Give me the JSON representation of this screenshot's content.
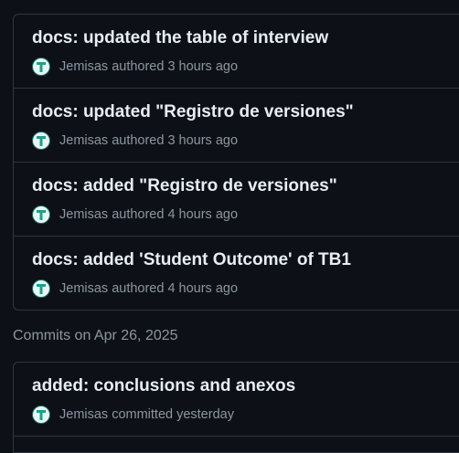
{
  "group_1": {
    "commits": [
      {
        "title": "docs: updated the table of interview",
        "author": "Jemisas",
        "verb": "authored",
        "time": "3 hours ago"
      },
      {
        "title": "docs: updated \"Registro de versiones\"",
        "author": "Jemisas",
        "verb": "authored",
        "time": "3 hours ago"
      },
      {
        "title": "docs: added \"Registro de versiones\"",
        "author": "Jemisas",
        "verb": "authored",
        "time": "4 hours ago"
      },
      {
        "title": "docs: added 'Student Outcome' of TB1",
        "author": "Jemisas",
        "verb": "authored",
        "time": "4 hours ago"
      }
    ]
  },
  "group_2": {
    "header": "Commits on Apr 26, 2025",
    "commits": [
      {
        "title": "added: conclusions and anexos",
        "author": "Jemisas",
        "verb": "committed",
        "time": "yesterday"
      }
    ]
  },
  "colors": {
    "background": "#0d1117",
    "border": "#30363d",
    "title_text": "#e6edf3",
    "muted_text": "#8d96a0",
    "avatar_accent": "#1f9e8f"
  },
  "icons": {
    "avatar": "user-avatar-icon"
  }
}
